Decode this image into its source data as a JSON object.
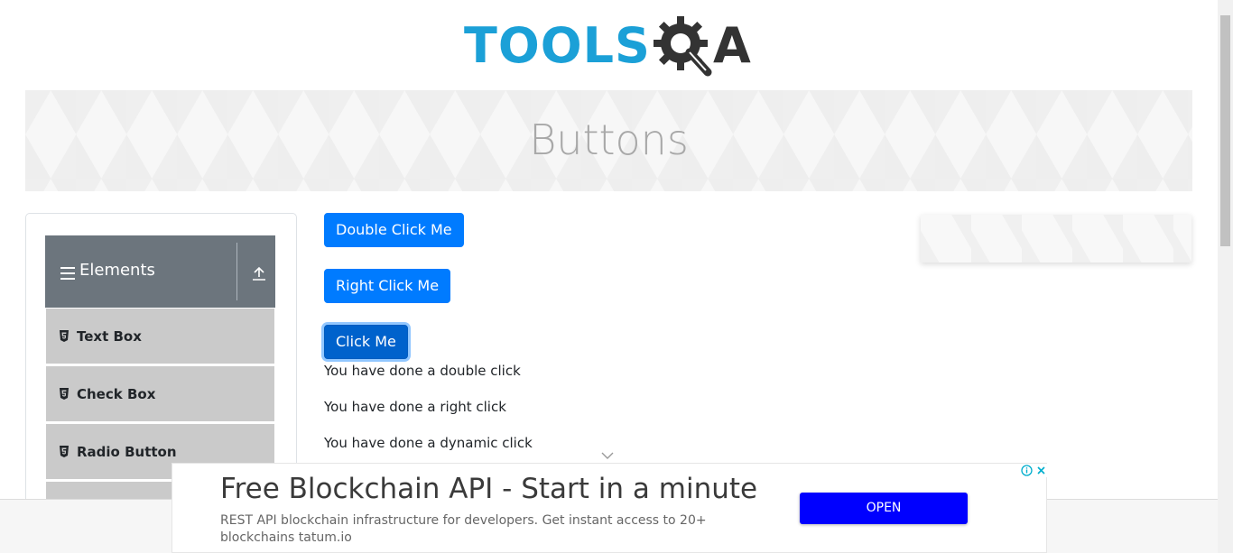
{
  "header": {
    "logo_part1": "TOOLS",
    "logo_part2": "A"
  },
  "banner": {
    "title": "Buttons"
  },
  "sidebar": {
    "group": {
      "title": "Elements",
      "icon": "hamburger-icon",
      "toggle_icon": "collapse-icon"
    },
    "items": [
      {
        "label": "Text Box",
        "icon": "html5-icon"
      },
      {
        "label": "Check Box",
        "icon": "html5-icon"
      },
      {
        "label": "Radio Button",
        "icon": "html5-icon"
      }
    ]
  },
  "main": {
    "buttons": {
      "double_click": "Double Click Me",
      "right_click": "Right Click Me",
      "click": "Click Me"
    },
    "messages": {
      "double": "You have done a double click",
      "right": "You have done a right click",
      "dynamic": "You have done a dynamic click"
    }
  },
  "ad": {
    "title": "Free Blockchain API - Start in a minute",
    "description": "REST API blockchain infrastructure for developers. Get instant access to 20+ blockchains tatum.io",
    "open_label": "OPEN"
  },
  "colors": {
    "primary": "#007bff",
    "sidebar_header": "#6c757d",
    "menu_item": "#cacaca",
    "logo_blue": "#1ba0d7",
    "ad_button": "#0000ff"
  }
}
